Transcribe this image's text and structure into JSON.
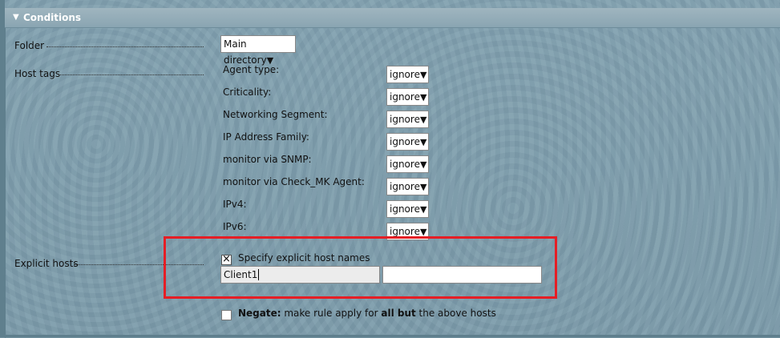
{
  "section": {
    "title": "Conditions",
    "toggle_icon": "triangle-down-icon"
  },
  "folder": {
    "label": "Folder",
    "selected": "Main directory"
  },
  "host_tags": {
    "label": "Host tags",
    "tags": [
      {
        "name": "Agent type:",
        "value": "ignore"
      },
      {
        "name": "Criticality:",
        "value": "ignore"
      },
      {
        "name": "Networking Segment:",
        "value": "ignore"
      },
      {
        "name": "IP Address Family:",
        "value": "ignore"
      },
      {
        "name": "monitor via SNMP:",
        "value": "ignore"
      },
      {
        "name": "monitor via Check_MK Agent:",
        "value": "ignore"
      },
      {
        "name": "IPv4:",
        "value": "ignore"
      },
      {
        "name": "IPv6:",
        "value": "ignore"
      }
    ]
  },
  "explicit_hosts": {
    "label": "Explicit hosts",
    "specify_label": "Specify explicit host names",
    "specify_checked": true,
    "host_values": [
      "Client1",
      ""
    ]
  },
  "negate": {
    "bold_label": "Negate:",
    "text_before": " make rule apply for ",
    "bold_middle": "all but",
    "text_after": " the above hosts",
    "checked": false
  },
  "colors": {
    "highlight": "#e51e25",
    "background": "#7f9fae",
    "header": "#9fb5bf"
  }
}
